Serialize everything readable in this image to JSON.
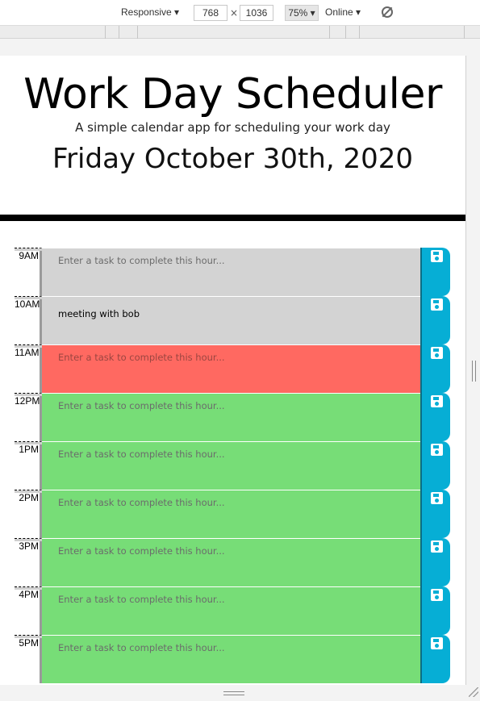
{
  "devtools": {
    "device_label": "Responsive ▾",
    "width_value": "768",
    "times_symbol": "×",
    "height_value": "1036",
    "zoom_label": "75% ▾",
    "network_label": "Online ▾"
  },
  "header": {
    "title": "Work Day Scheduler",
    "subtitle": "A simple calendar app for scheduling your work day",
    "current_day": "Friday October 30th, 2020"
  },
  "schedule": {
    "placeholder": "Enter a task to complete this hour...",
    "blocks": [
      {
        "hour": "9AM",
        "state": "past",
        "text": ""
      },
      {
        "hour": "10AM",
        "state": "past",
        "text": "meeting with bob"
      },
      {
        "hour": "11AM",
        "state": "present",
        "text": ""
      },
      {
        "hour": "12PM",
        "state": "future",
        "text": ""
      },
      {
        "hour": "1PM",
        "state": "future",
        "text": ""
      },
      {
        "hour": "2PM",
        "state": "future",
        "text": ""
      },
      {
        "hour": "3PM",
        "state": "future",
        "text": ""
      },
      {
        "hour": "4PM",
        "state": "future",
        "text": ""
      },
      {
        "hour": "5PM",
        "state": "future",
        "text": ""
      }
    ],
    "save_icon": "floppy-disk-icon"
  },
  "colors": {
    "past": "#d3d3d3",
    "present": "#ff6961",
    "future": "#77dd77",
    "save_button": "#06aed5"
  }
}
